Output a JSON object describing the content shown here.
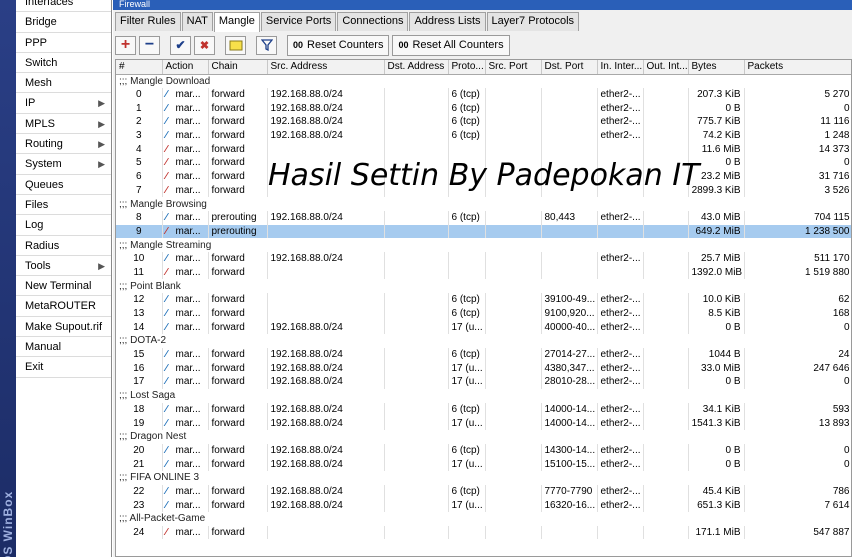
{
  "brand": "OS WinBox",
  "window_title": "Firewall",
  "sidebar": {
    "items": [
      {
        "label": "Interfaces",
        "submenu": false
      },
      {
        "label": "Bridge",
        "submenu": false
      },
      {
        "label": "PPP",
        "submenu": false
      },
      {
        "label": "Switch",
        "submenu": false
      },
      {
        "label": "Mesh",
        "submenu": false
      },
      {
        "label": "IP",
        "submenu": true
      },
      {
        "label": "MPLS",
        "submenu": true
      },
      {
        "label": "Routing",
        "submenu": true
      },
      {
        "label": "System",
        "submenu": true
      },
      {
        "label": "Queues",
        "submenu": false
      },
      {
        "label": "Files",
        "submenu": false
      },
      {
        "label": "Log",
        "submenu": false
      },
      {
        "label": "Radius",
        "submenu": false
      },
      {
        "label": "Tools",
        "submenu": true
      },
      {
        "label": "New Terminal",
        "submenu": false
      },
      {
        "label": "MetaROUTER",
        "submenu": false
      },
      {
        "label": "Make Supout.rif",
        "submenu": false
      },
      {
        "label": "Manual",
        "submenu": false
      },
      {
        "label": "Exit",
        "submenu": false
      }
    ]
  },
  "tabs": [
    {
      "label": "Filter Rules",
      "active": false
    },
    {
      "label": "NAT",
      "active": false
    },
    {
      "label": "Mangle",
      "active": true
    },
    {
      "label": "Service Ports",
      "active": false
    },
    {
      "label": "Connections",
      "active": false
    },
    {
      "label": "Address Lists",
      "active": false
    },
    {
      "label": "Layer7 Protocols",
      "active": false
    }
  ],
  "toolbar": {
    "add": "+",
    "remove": "−",
    "enable": "✔",
    "disable": "✖",
    "reset_counters_label": "Reset Counters",
    "reset_all_label": "Reset All Counters",
    "counter_glyph": "00"
  },
  "table": {
    "columns": [
      "#",
      "Action",
      "Chain",
      "Src. Address",
      "Dst. Address",
      "Proto...",
      "Src. Port",
      "Dst. Port",
      "In. Inter...",
      "Out. Int...",
      "Bytes",
      "Packets"
    ],
    "rows": [
      {
        "comment": ";;; Mangle Download"
      },
      {
        "num": "0",
        "action": "mar...",
        "chain": "forward",
        "src": "192.168.88.0/24",
        "dst": "",
        "proto": "6 (tcp)",
        "sport": "",
        "dport": "",
        "inif": "ether2-...",
        "outif": "",
        "bytes": "207.3 KiB",
        "packets": "5 270",
        "enabled": true
      },
      {
        "num": "1",
        "action": "mar...",
        "chain": "forward",
        "src": "192.168.88.0/24",
        "dst": "",
        "proto": "6 (tcp)",
        "sport": "",
        "dport": "",
        "inif": "ether2-...",
        "outif": "",
        "bytes": "0 B",
        "packets": "0",
        "enabled": true
      },
      {
        "num": "2",
        "action": "mar...",
        "chain": "forward",
        "src": "192.168.88.0/24",
        "dst": "",
        "proto": "6 (tcp)",
        "sport": "",
        "dport": "",
        "inif": "ether2-...",
        "outif": "",
        "bytes": "775.7 KiB",
        "packets": "11 116",
        "enabled": true
      },
      {
        "num": "3",
        "action": "mar...",
        "chain": "forward",
        "src": "192.168.88.0/24",
        "dst": "",
        "proto": "6 (tcp)",
        "sport": "",
        "dport": "",
        "inif": "ether2-...",
        "outif": "",
        "bytes": "74.2 KiB",
        "packets": "1 248",
        "enabled": true
      },
      {
        "num": "4",
        "action": "mar...",
        "chain": "forward",
        "src": "",
        "dst": "",
        "proto": "",
        "sport": "",
        "dport": "",
        "inif": "",
        "outif": "",
        "bytes": "11.6 MiB",
        "packets": "14 373",
        "enabled": false
      },
      {
        "num": "5",
        "action": "mar...",
        "chain": "forward",
        "src": "",
        "dst": "",
        "proto": "",
        "sport": "",
        "dport": "",
        "inif": "",
        "outif": "",
        "bytes": "0 B",
        "packets": "0",
        "enabled": false
      },
      {
        "num": "6",
        "action": "mar...",
        "chain": "forward",
        "src": "",
        "dst": "",
        "proto": "",
        "sport": "",
        "dport": "",
        "inif": "",
        "outif": "",
        "bytes": "23.2 MiB",
        "packets": "31 716",
        "enabled": false
      },
      {
        "num": "7",
        "action": "mar...",
        "chain": "forward",
        "src": "",
        "dst": "",
        "proto": "",
        "sport": "",
        "dport": "",
        "inif": "",
        "outif": "",
        "bytes": "2899.3 KiB",
        "packets": "3 526",
        "enabled": false
      },
      {
        "comment": ";;; Mangle Browsing"
      },
      {
        "num": "8",
        "action": "mar...",
        "chain": "prerouting",
        "src": "192.168.88.0/24",
        "dst": "",
        "proto": "6 (tcp)",
        "sport": "",
        "dport": "80,443",
        "inif": "ether2-...",
        "outif": "",
        "bytes": "43.0 MiB",
        "packets": "704 115",
        "enabled": true
      },
      {
        "num": "9",
        "action": "mar...",
        "chain": "prerouting",
        "src": "",
        "dst": "",
        "proto": "",
        "sport": "",
        "dport": "",
        "inif": "",
        "outif": "",
        "bytes": "649.2 MiB",
        "packets": "1 238 500",
        "enabled": false,
        "selected": true
      },
      {
        "comment": ";;; Mangle Streaming"
      },
      {
        "num": "10",
        "action": "mar...",
        "chain": "forward",
        "src": "192.168.88.0/24",
        "dst": "",
        "proto": "",
        "sport": "",
        "dport": "",
        "inif": "ether2-...",
        "outif": "",
        "bytes": "25.7 MiB",
        "packets": "511 170",
        "enabled": true
      },
      {
        "num": "11",
        "action": "mar...",
        "chain": "forward",
        "src": "",
        "dst": "",
        "proto": "",
        "sport": "",
        "dport": "",
        "inif": "",
        "outif": "",
        "bytes": "1392.0 MiB",
        "packets": "1 519 880",
        "enabled": false
      },
      {
        "comment": ";;; Point Blank"
      },
      {
        "num": "12",
        "action": "mar...",
        "chain": "forward",
        "src": "",
        "dst": "",
        "proto": "6 (tcp)",
        "sport": "",
        "dport": "39100-49...",
        "inif": "ether2-...",
        "outif": "",
        "bytes": "10.0 KiB",
        "packets": "62",
        "enabled": true
      },
      {
        "num": "13",
        "action": "mar...",
        "chain": "forward",
        "src": "",
        "dst": "",
        "proto": "6 (tcp)",
        "sport": "",
        "dport": "9100,920...",
        "inif": "ether2-...",
        "outif": "",
        "bytes": "8.5 KiB",
        "packets": "168",
        "enabled": true
      },
      {
        "num": "14",
        "action": "mar...",
        "chain": "forward",
        "src": "192.168.88.0/24",
        "dst": "",
        "proto": "17 (u...",
        "sport": "",
        "dport": "40000-40...",
        "inif": "ether2-...",
        "outif": "",
        "bytes": "0 B",
        "packets": "0",
        "enabled": true
      },
      {
        "comment": ";;; DOTA-2"
      },
      {
        "num": "15",
        "action": "mar...",
        "chain": "forward",
        "src": "192.168.88.0/24",
        "dst": "",
        "proto": "6 (tcp)",
        "sport": "",
        "dport": "27014-27...",
        "inif": "ether2-...",
        "outif": "",
        "bytes": "1044 B",
        "packets": "24",
        "enabled": true
      },
      {
        "num": "16",
        "action": "mar...",
        "chain": "forward",
        "src": "192.168.88.0/24",
        "dst": "",
        "proto": "17 (u...",
        "sport": "",
        "dport": "4380,347...",
        "inif": "ether2-...",
        "outif": "",
        "bytes": "33.0 MiB",
        "packets": "247 646",
        "enabled": true
      },
      {
        "num": "17",
        "action": "mar...",
        "chain": "forward",
        "src": "192.168.88.0/24",
        "dst": "",
        "proto": "17 (u...",
        "sport": "",
        "dport": "28010-28...",
        "inif": "ether2-...",
        "outif": "",
        "bytes": "0 B",
        "packets": "0",
        "enabled": true
      },
      {
        "comment": ";;; Lost Saga"
      },
      {
        "num": "18",
        "action": "mar...",
        "chain": "forward",
        "src": "192.168.88.0/24",
        "dst": "",
        "proto": "6 (tcp)",
        "sport": "",
        "dport": "14000-14...",
        "inif": "ether2-...",
        "outif": "",
        "bytes": "34.1 KiB",
        "packets": "593",
        "enabled": true
      },
      {
        "num": "19",
        "action": "mar...",
        "chain": "forward",
        "src": "192.168.88.0/24",
        "dst": "",
        "proto": "17 (u...",
        "sport": "",
        "dport": "14000-14...",
        "inif": "ether2-...",
        "outif": "",
        "bytes": "1541.3 KiB",
        "packets": "13 893",
        "enabled": true
      },
      {
        "comment": ";;; Dragon Nest"
      },
      {
        "num": "20",
        "action": "mar...",
        "chain": "forward",
        "src": "192.168.88.0/24",
        "dst": "",
        "proto": "6 (tcp)",
        "sport": "",
        "dport": "14300-14...",
        "inif": "ether2-...",
        "outif": "",
        "bytes": "0 B",
        "packets": "0",
        "enabled": true
      },
      {
        "num": "21",
        "action": "mar...",
        "chain": "forward",
        "src": "192.168.88.0/24",
        "dst": "",
        "proto": "17 (u...",
        "sport": "",
        "dport": "15100-15...",
        "inif": "ether2-...",
        "outif": "",
        "bytes": "0 B",
        "packets": "0",
        "enabled": true
      },
      {
        "comment": ";;; FIFA ONLINE 3"
      },
      {
        "num": "22",
        "action": "mar...",
        "chain": "forward",
        "src": "192.168.88.0/24",
        "dst": "",
        "proto": "6 (tcp)",
        "sport": "",
        "dport": "7770-7790",
        "inif": "ether2-...",
        "outif": "",
        "bytes": "45.4 KiB",
        "packets": "786",
        "enabled": true
      },
      {
        "num": "23",
        "action": "mar...",
        "chain": "forward",
        "src": "192.168.88.0/24",
        "dst": "",
        "proto": "17 (u...",
        "sport": "",
        "dport": "16320-16...",
        "inif": "ether2-...",
        "outif": "",
        "bytes": "651.3 KiB",
        "packets": "7 614",
        "enabled": true
      },
      {
        "comment": ";;; All-Packet-Game"
      },
      {
        "num": "24",
        "action": "mar...",
        "chain": "forward",
        "src": "",
        "dst": "",
        "proto": "",
        "sport": "",
        "dport": "",
        "inif": "",
        "outif": "",
        "bytes": "171.1 MiB",
        "packets": "547 887",
        "enabled": false
      }
    ]
  },
  "overlay_text": "Hasil Settin By Padepokan IT",
  "colors": {
    "selected_row": "#a6cbef",
    "accent_blue": "#2a5fb8",
    "disabled_icon": "#c0322d",
    "enabled_icon": "#1d6fb8"
  }
}
